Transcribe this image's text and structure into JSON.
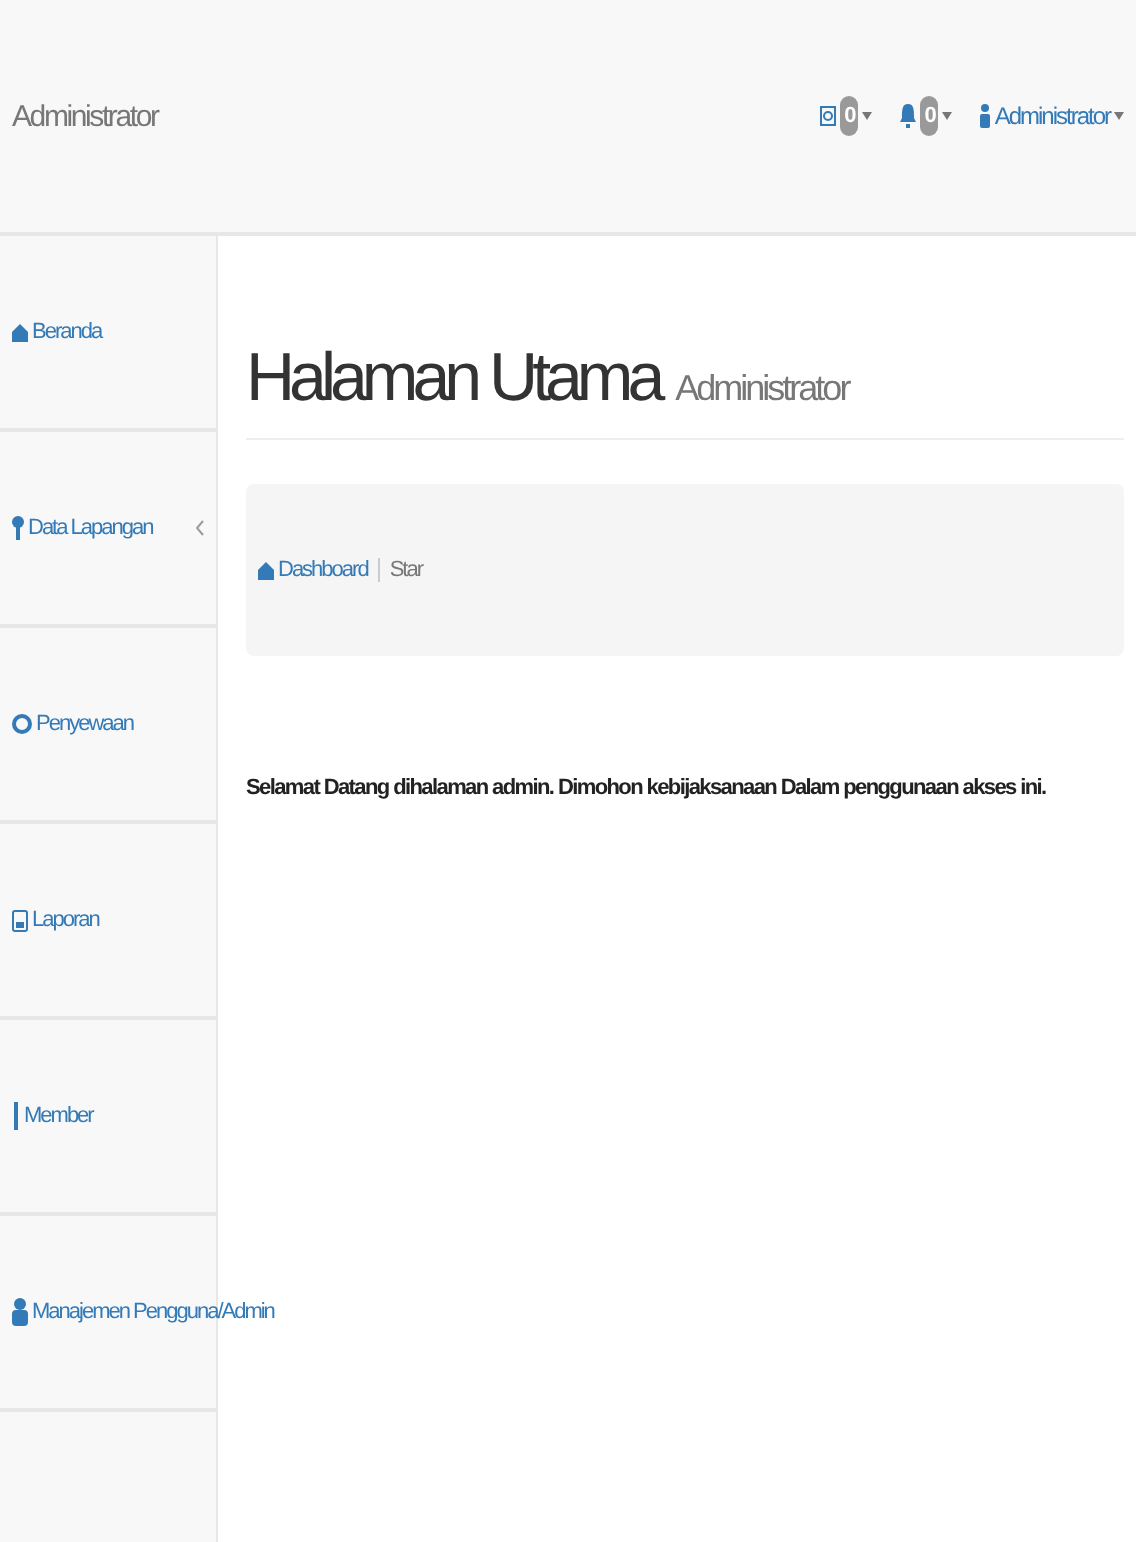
{
  "navbar": {
    "brand": "Administrator",
    "messages": {
      "count": "0"
    },
    "alerts": {
      "count": "0"
    },
    "user": {
      "label": "Administrator"
    }
  },
  "sidebar": {
    "items": [
      {
        "label": "Beranda",
        "expandable": false
      },
      {
        "label": "Data Lapangan",
        "expandable": true
      },
      {
        "label": "Penyewaan",
        "expandable": false
      },
      {
        "label": "Laporan",
        "expandable": false
      },
      {
        "label": "Member",
        "expandable": false
      },
      {
        "label": "Manajemen Pengguna/Admin",
        "expandable": false
      }
    ]
  },
  "page": {
    "title": "Halaman Utama",
    "subtitle": "Administrator",
    "breadcrumb": [
      "Dashboard",
      "Star"
    ],
    "message": "Selamat Datang dihalaman admin. Dimohon kebijaksanaan Dalam penggunaan akses ini."
  }
}
